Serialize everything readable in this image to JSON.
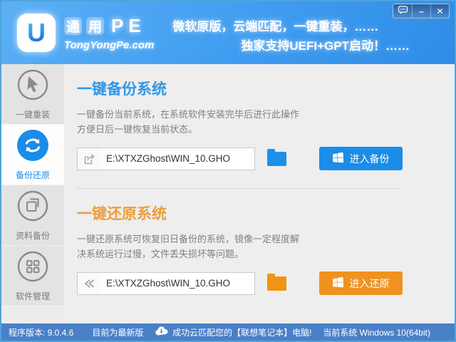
{
  "window": {
    "controls": {
      "minimize_label": "–",
      "close_label": "✕"
    }
  },
  "header": {
    "logo_letter": "U",
    "brand_char1": "通",
    "brand_char2": "用",
    "brand_letters": "PE",
    "brand_domain": "TongYongPe.com",
    "slogan_line1": "微软原版，云端匹配，一键重装，……",
    "slogan_line2": "独家支持UEFI+GPT启动！……"
  },
  "sidebar": {
    "items": [
      {
        "label": "一键重装",
        "icon": "cursor-icon",
        "active": false
      },
      {
        "label": "备份还原",
        "icon": "sync-icon",
        "active": true
      },
      {
        "label": "资料备份",
        "icon": "copy-icon",
        "active": false
      },
      {
        "label": "软件管理",
        "icon": "grid-icon",
        "active": false
      }
    ]
  },
  "backup": {
    "title": "一键备份系统",
    "desc_line1": "一键备份当前系统，在系统软件安装完毕后进行此操作",
    "desc_line2": "方便日后一键恢复当前状态。",
    "path": "E:\\XTXZGhost\\WIN_10.GHO",
    "button_label": "进入备份",
    "accent_color": "#1b8ce8"
  },
  "restore": {
    "title": "一键还原系统",
    "desc_line1": "一键还原系统可恢复旧日备份的系统，镜像一定程度解",
    "desc_line2": "决系统运行过慢，文件丢失损坏等问题。",
    "path": "E:\\XTXZGhost\\WIN_10.GHO",
    "button_label": "进入还原",
    "accent_color": "#ef9220"
  },
  "statusbar": {
    "version": "程序版本: 9.0.4.6",
    "update_status": "目前为最新版",
    "cloud_message": "成功云匹配您的【联想笔记本】电脑!",
    "system_info": "当前系统 Windows 10(64bit)"
  }
}
